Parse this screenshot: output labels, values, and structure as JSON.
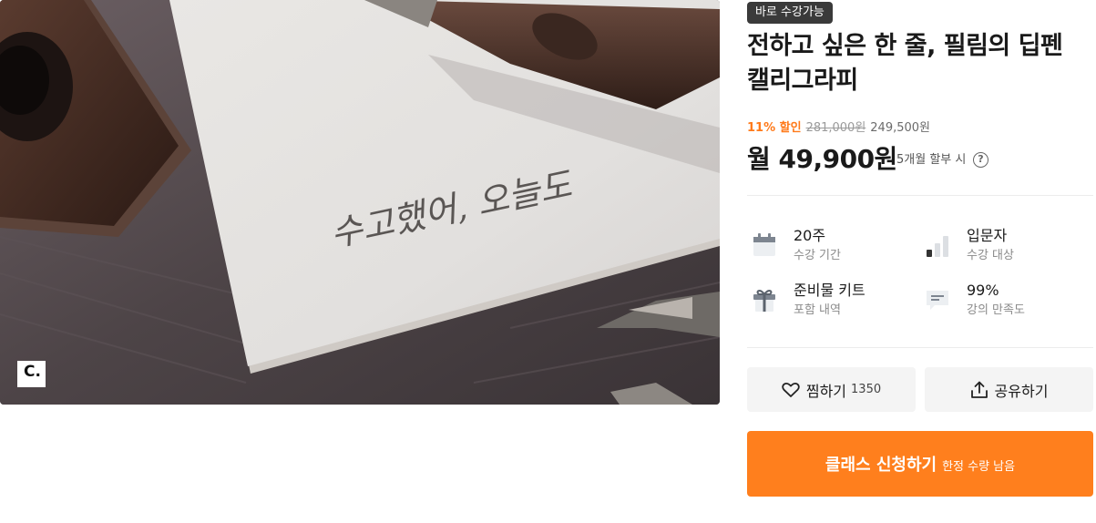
{
  "hero": {
    "handwriting": "수고했어, 오늘도",
    "brand_logo_text": "C."
  },
  "badge": "바로 수강가능",
  "title": "전하고 싶은 한 줄, 필림의 딥펜 캘리그라피",
  "price": {
    "discount": "11% 할인",
    "original": "281,000원",
    "sale": "249,500원",
    "monthly": "월 49,900원",
    "installment": "5개월 할부 시",
    "help_icon": "?"
  },
  "info": [
    {
      "value": "20주",
      "label": "수강 기간",
      "icon": "calendar-icon"
    },
    {
      "value": "입문자",
      "label": "수강 대상",
      "icon": "level-bars-icon"
    },
    {
      "value": "준비물 키트",
      "label": "포함 내역",
      "icon": "gift-icon"
    },
    {
      "value": "99%",
      "label": "강의 만족도",
      "icon": "message-icon"
    }
  ],
  "actions": {
    "like_label": "찜하기",
    "like_count": "1350",
    "share_label": "공유하기"
  },
  "cta": {
    "main": "클래스 신청하기",
    "sub": "한정 수량 남음"
  },
  "colors": {
    "accent": "#ff7f1d",
    "discount": "#ff7a1a",
    "badge_bg": "#3a3a3a"
  }
}
